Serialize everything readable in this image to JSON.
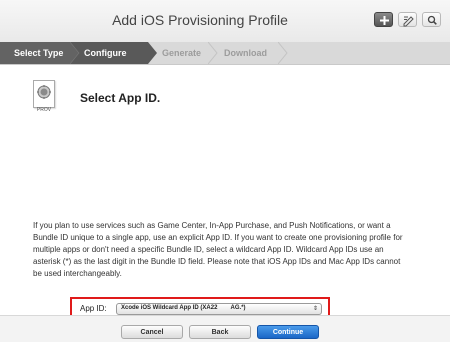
{
  "window": {
    "title": "Add iOS Provisioning Profile"
  },
  "toolbar": {
    "icons": [
      "plus-icon",
      "edit-icon",
      "search-icon"
    ]
  },
  "steps": [
    {
      "label": "Select Type",
      "state": "done"
    },
    {
      "label": "Configure",
      "state": "current"
    },
    {
      "label": "Generate",
      "state": "upcoming"
    },
    {
      "label": "Download",
      "state": "upcoming"
    }
  ],
  "main": {
    "icon_caption": "PROV",
    "heading": "Select App ID.",
    "description": "If you plan to use services such as Game Center, In-App Purchase, and Push Notifications, or want a Bundle ID unique to a single app, use an explicit App ID. If you want to create one provisioning profile for multiple apps or don't need a specific Bundle ID, select a wildcard App ID. Wildcard App IDs use an asterisk (*) as the last digit in the Bundle ID field. Please note that iOS App IDs and Mac App IDs cannot be used interchangeably.",
    "app_id_label": "App ID:",
    "app_id_value": "Xcode iOS Wildcard App ID (XA22        AG.*)",
    "highlight_color": "#e01a1a"
  },
  "footer": {
    "cancel": "Cancel",
    "back": "Back",
    "continue": "Continue"
  },
  "colors": {
    "primary_button": "#1b67c7"
  }
}
